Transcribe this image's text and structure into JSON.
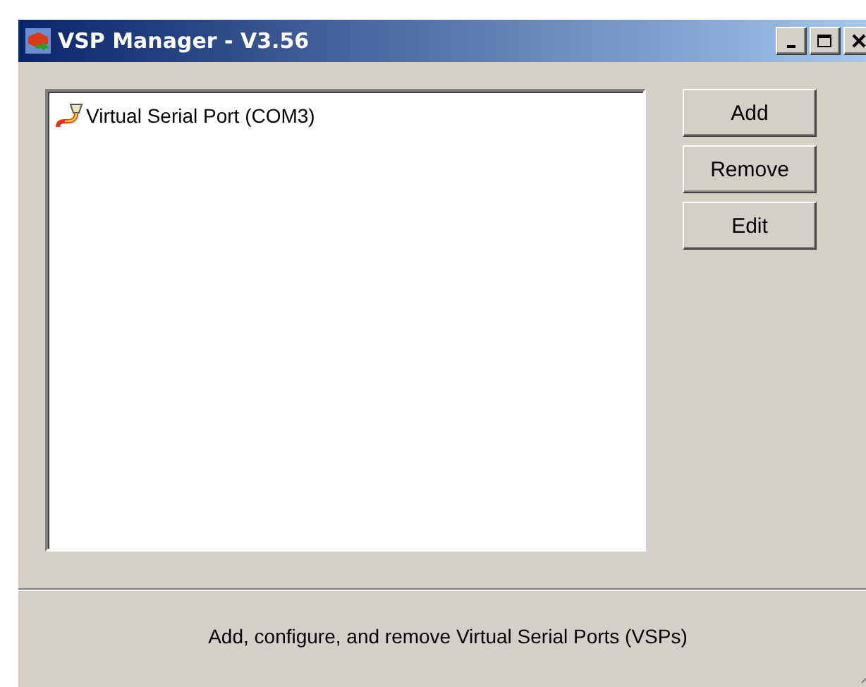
{
  "window": {
    "title": "VSP Manager - V3.56"
  },
  "ports": [
    {
      "label": "Virtual Serial Port (COM3)",
      "selected": false
    }
  ],
  "buttons": [
    "Add",
    "Remove",
    "Edit"
  ],
  "status_bar": "Add, configure, and remove Virtual Serial Ports (VSPs)"
}
